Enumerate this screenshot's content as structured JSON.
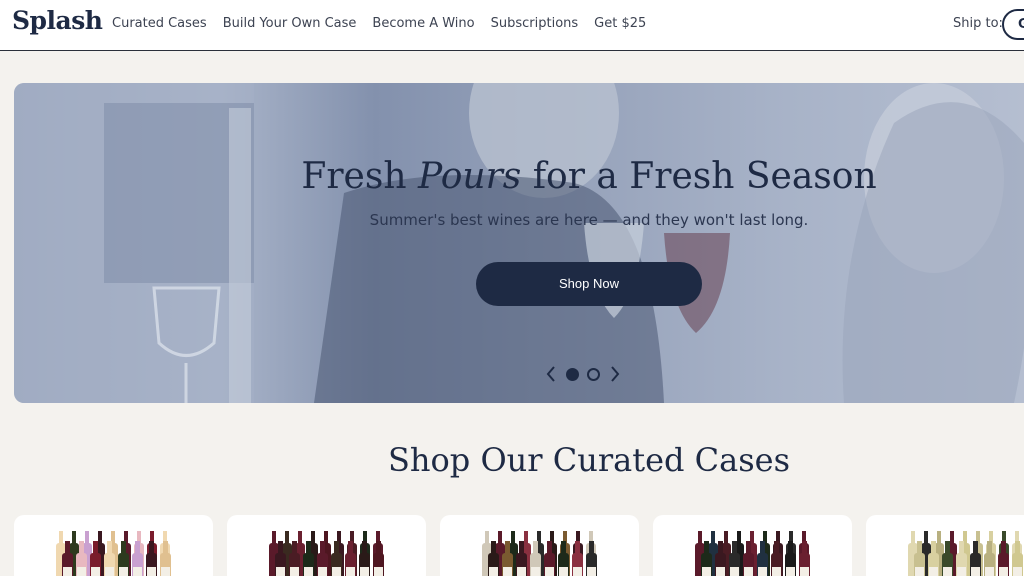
{
  "brand": {
    "logo_text": "Splash"
  },
  "nav": {
    "items": [
      {
        "label": "Curated Cases"
      },
      {
        "label": "Build Your Own Case"
      },
      {
        "label": "Become A Wino"
      },
      {
        "label": "Subscriptions"
      },
      {
        "label": "Get $25"
      }
    ],
    "ship_label": "Ship to:",
    "ship_value": "G"
  },
  "hero": {
    "title_part1": "Fresh ",
    "title_italic": "Pours",
    "title_part2": " for a Fresh Season",
    "subtitle": "Summer's best wines are here — and they won't last long.",
    "cta_label": "Shop Now",
    "carousel": {
      "slide_count": 2,
      "active_index": 0
    }
  },
  "section": {
    "title": "Shop Our Curated Cases"
  },
  "cards": [
    {
      "palette": [
        "#5a1a2a",
        "#e8b8c0",
        "#7a1c2c",
        "#f0d8b0",
        "#2d3a1e",
        "#c9a0d0",
        "#3a1820",
        "#e0c090"
      ]
    },
    {
      "palette": [
        "#3a1820",
        "#4a1c24",
        "#1d2a1a",
        "#5a1a2a",
        "#3a2a20",
        "#6a2030",
        "#2a1a18",
        "#4e1620"
      ]
    },
    {
      "palette": [
        "#2a1a18",
        "#7a5a30",
        "#3a1820",
        "#d0c8b8",
        "#5a1a2a",
        "#1d2a1a",
        "#8a3040",
        "#2a2a2a"
      ]
    },
    {
      "palette": [
        "#1d2a1a",
        "#3a1820",
        "#2a2a2a",
        "#5a1a2a",
        "#203040",
        "#4a1c24",
        "#1a1a1a",
        "#6a2030"
      ]
    },
    {
      "palette": [
        "#c8c090",
        "#d8d0a0",
        "#3a4a2a",
        "#e0d8b0",
        "#2a2a2a",
        "#b8b080",
        "#5a1a2a",
        "#d0c890"
      ]
    }
  ]
}
